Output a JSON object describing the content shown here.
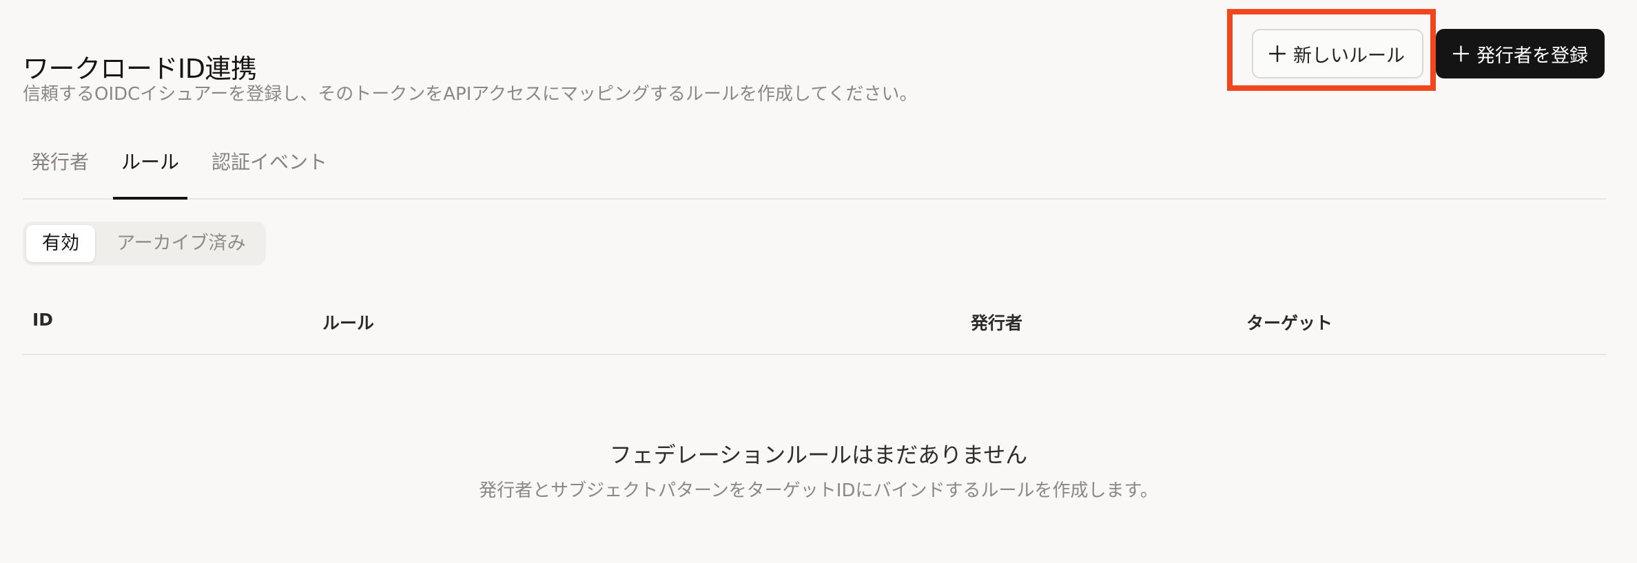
{
  "header": {
    "title": "ワークロードID連携",
    "description": "信頼するOIDCイシュアーを登録し、そのトークンをAPIアクセスにマッピングするルールを作成してください。"
  },
  "actions": {
    "new_rule_label": "新しいルール",
    "register_issuer_label": "発行者を登録",
    "icon": "plus-icon"
  },
  "tabs": [
    {
      "label": "発行者",
      "active": false
    },
    {
      "label": "ルール",
      "active": true
    },
    {
      "label": "認証イベント",
      "active": false
    }
  ],
  "filter": {
    "options": [
      {
        "label": "有効",
        "selected": true
      },
      {
        "label": "アーカイブ済み",
        "selected": false
      }
    ]
  },
  "table": {
    "columns": [
      "ID",
      "ルール",
      "発行者",
      "ターゲット"
    ],
    "rows": []
  },
  "empty_state": {
    "title": "フェデレーションルールはまだありません",
    "subtitle": "発行者とサブジェクトパターンをターゲットIDにバインドするルールを作成します。"
  },
  "colors": {
    "background": "#f9f8f6",
    "primary_button": "#141414",
    "highlight": "#f0471f",
    "muted_text": "#8a8884"
  }
}
